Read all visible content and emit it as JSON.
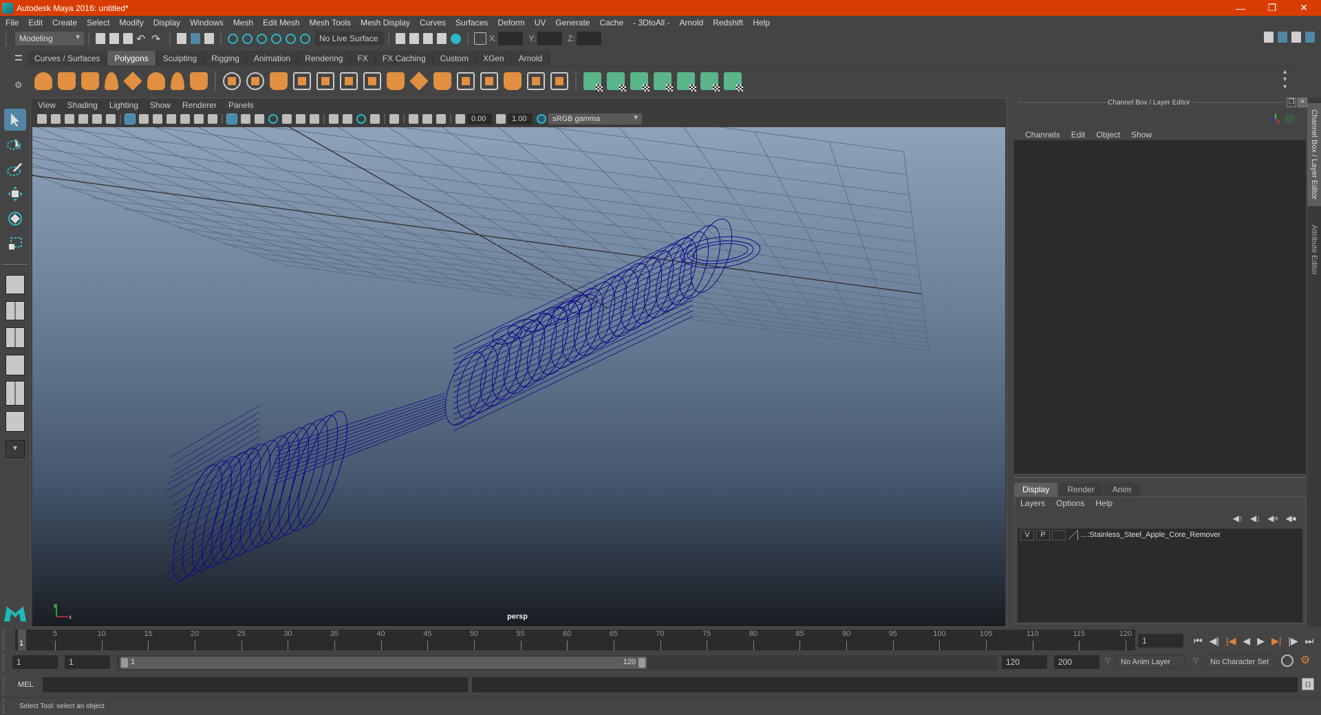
{
  "window": {
    "title": "Autodesk Maya 2016: untitled*",
    "controls": [
      "minimize",
      "restore",
      "close"
    ]
  },
  "menubar": [
    "File",
    "Edit",
    "Create",
    "Select",
    "Modify",
    "Display",
    "Windows",
    "Mesh",
    "Edit Mesh",
    "Mesh Tools",
    "Mesh Display",
    "Curves",
    "Surfaces",
    "Deform",
    "UV",
    "Generate",
    "Cache",
    "- 3DtoAll -",
    "Arnold",
    "Redshift",
    "Help"
  ],
  "statusline": {
    "mode": "Modeling",
    "live_surface": "No Live Surface",
    "x_label": "X:",
    "y_label": "Y:",
    "z_label": "Z:",
    "x_value": "",
    "y_value": "",
    "z_value": ""
  },
  "shelf": {
    "tabs": [
      "Curves / Surfaces",
      "Polygons",
      "Sculpting",
      "Rigging",
      "Animation",
      "Rendering",
      "FX",
      "FX Caching",
      "Custom",
      "XGen",
      "Arnold"
    ],
    "active_tab": "Polygons",
    "primitive_icons": [
      "poly-sphere-icon",
      "poly-cube-icon",
      "poly-cylinder-icon",
      "poly-cone-icon",
      "poly-plane-icon",
      "poly-torus-icon",
      "poly-pyramid-icon",
      "poly-pipe-icon"
    ],
    "tool_icons": [
      "combine-icon",
      "separate-icon",
      "mirror-icon",
      "smooth-icon",
      "extract-icon",
      "boolean-icon",
      "multicut-icon",
      "bevel-icon",
      "bridge-icon",
      "extrude-icon",
      "insert-edge-loop-icon",
      "merge-icon",
      "fill-hole-icon",
      "target-weld-icon",
      "triangulate-icon"
    ],
    "uv_icons": [
      "planar-map-icon",
      "cylindrical-map-icon",
      "spherical-map-icon",
      "automatic-map-icon",
      "unfold-icon",
      "uv-editor-icon",
      "layout-uvs-icon"
    ]
  },
  "viewport": {
    "menu": [
      "View",
      "Shading",
      "Lighting",
      "Show",
      "Renderer",
      "Panels"
    ],
    "exposure": "0.00",
    "gamma": "1.00",
    "color_space": "sRGB gamma",
    "camera_label": "persp",
    "axis_labels": {
      "x": "x",
      "y": "y"
    },
    "wire_color": "#0a0a8a"
  },
  "channel_box": {
    "title": "Channel Box / Layer Editor",
    "menu": [
      "Channels",
      "Edit",
      "Object",
      "Show"
    ]
  },
  "layer_editor": {
    "tabs": [
      "Display",
      "Render",
      "Anim"
    ],
    "active_tab": "Display",
    "menu": [
      "Layers",
      "Options",
      "Help"
    ],
    "layers": [
      {
        "visible": "V",
        "playback": "P",
        "name": "...:Stainless_Steel_Apple_Core_Remover"
      }
    ]
  },
  "side_tabs": [
    "Channel Box / Layer Editor",
    "Attribute Editor"
  ],
  "timeline": {
    "ticks": [
      5,
      10,
      15,
      20,
      25,
      30,
      35,
      40,
      45,
      50,
      55,
      60,
      65,
      70,
      75,
      80,
      85,
      90,
      95,
      100,
      105,
      110,
      115,
      120
    ],
    "current_frame": "1",
    "current_frame_field": "1",
    "start": 1,
    "end": 120
  },
  "range": {
    "start_field": "1",
    "playback_start": "1",
    "range_start_label": "1",
    "range_end_label": "120",
    "playback_end": "120",
    "end_field": "200",
    "anim_layer": "No Anim Layer",
    "character_set": "No Character Set"
  },
  "command_line": {
    "label": "MEL",
    "value": "",
    "result": ""
  },
  "help_line": "Select Tool: select an object"
}
